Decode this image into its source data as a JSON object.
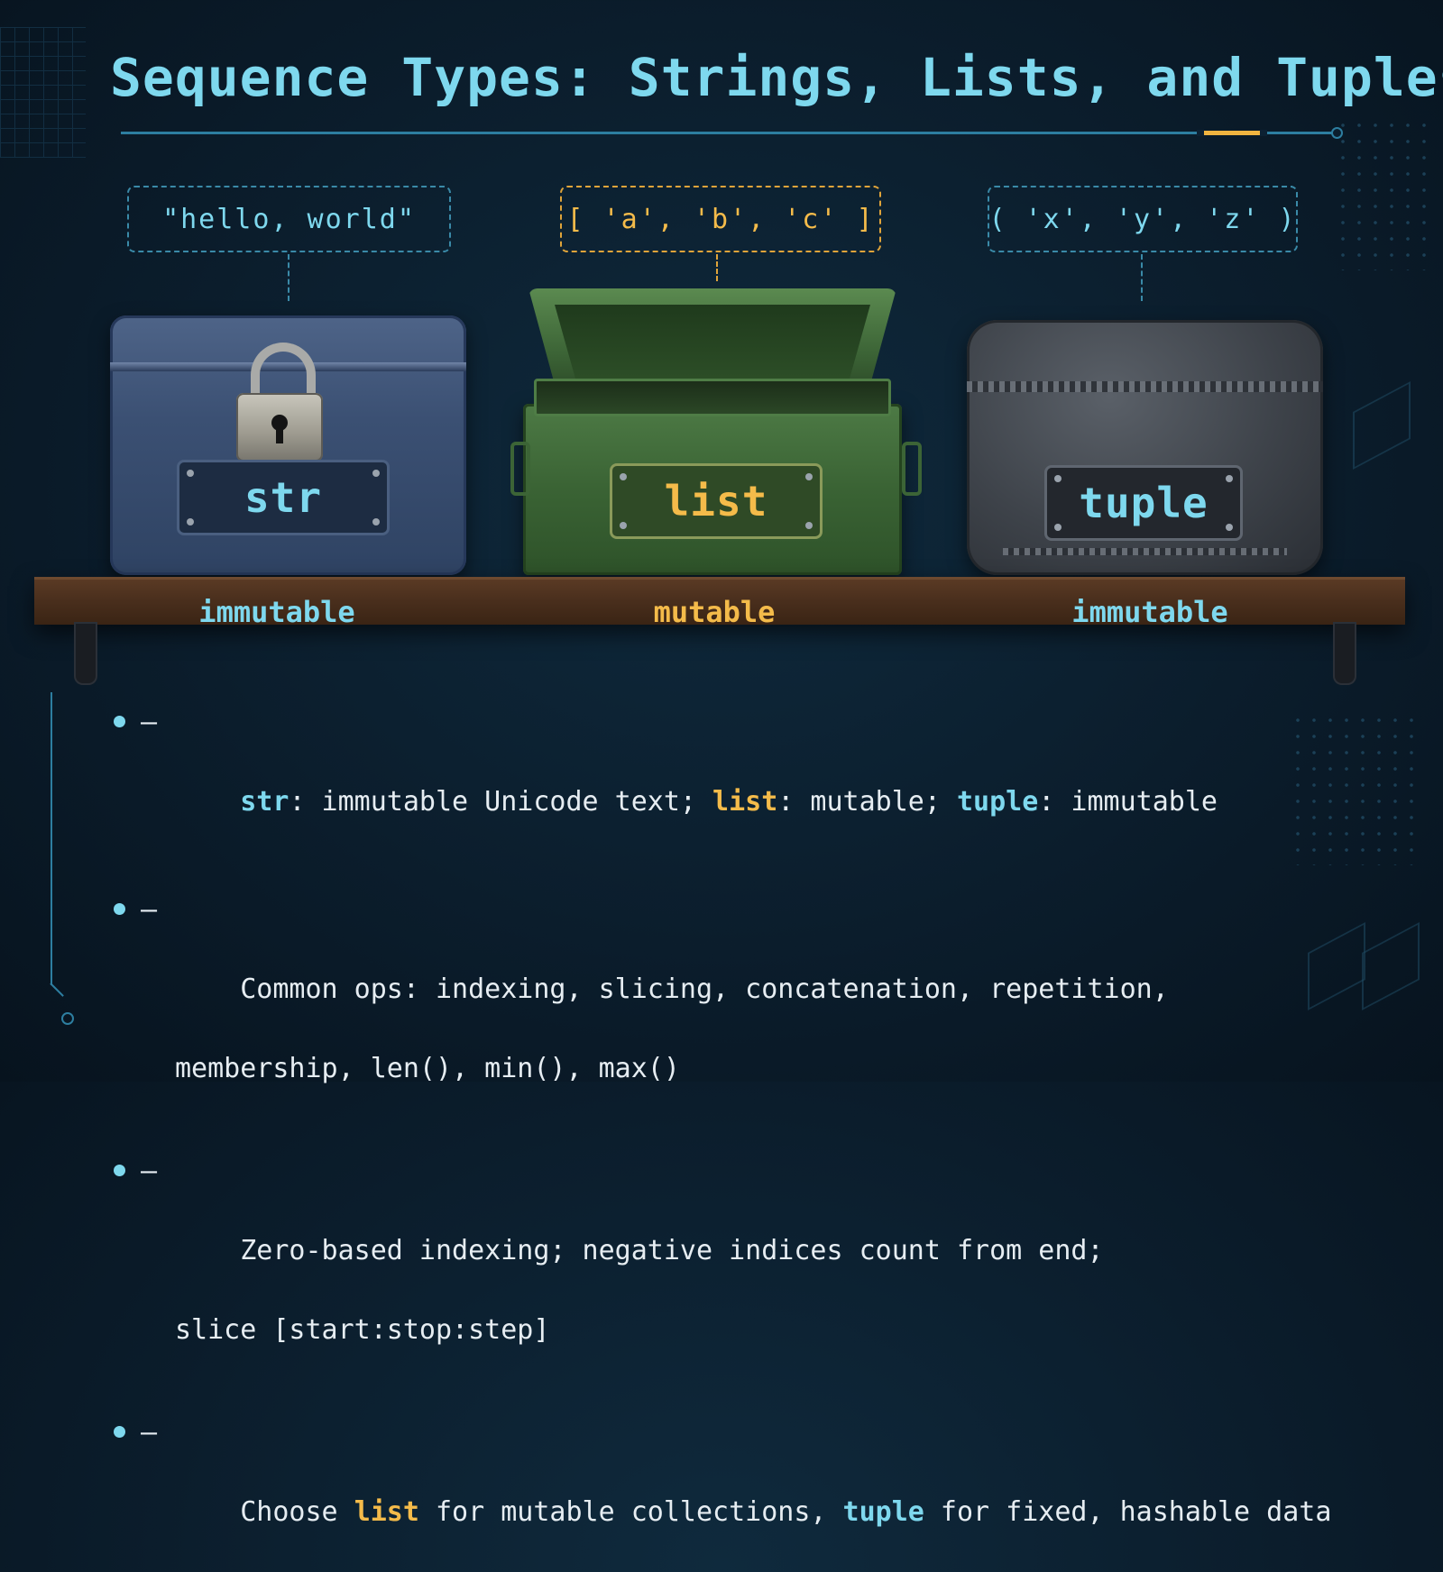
{
  "title": "Sequence Types: Strings, Lists, and Tuples",
  "literals": {
    "str": "\"hello, world\"",
    "list": "[ 'a', 'b', 'c' ]",
    "tuple": "( 'x', 'y', 'z' )"
  },
  "plates": {
    "str": "str",
    "list": "list",
    "tuple": "tuple"
  },
  "mutability": {
    "str": "immutable",
    "list": "mutable",
    "tuple": "immutable"
  },
  "bullets": {
    "dash": "–",
    "b1": {
      "str": "str",
      "t1": ": immutable Unicode text; ",
      "list": "list",
      "t2": ": mutable; ",
      "tuple": "tuple",
      "t3": ": immutable"
    },
    "b2": {
      "line1": "Common ops: indexing, slicing, concatenation, repetition,",
      "line2": "membership, len(), min(), max()"
    },
    "b3": {
      "line1": "Zero-based indexing; negative indices count from end;",
      "line2": "slice [start:stop:step]"
    },
    "b4": {
      "t1": "Choose ",
      "list": "list",
      "t2": " for mutable collections, ",
      "tuple": "tuple",
      "t3": " for fixed, hashable data"
    }
  },
  "colors": {
    "accent_cyan": "#7ed8ee",
    "accent_gold": "#f4bb4a",
    "background": "#0b1d2c"
  },
  "icons": [
    "padlock-icon",
    "str-box-icon",
    "list-box-icon",
    "tuple-box-icon",
    "shelf-icon"
  ]
}
